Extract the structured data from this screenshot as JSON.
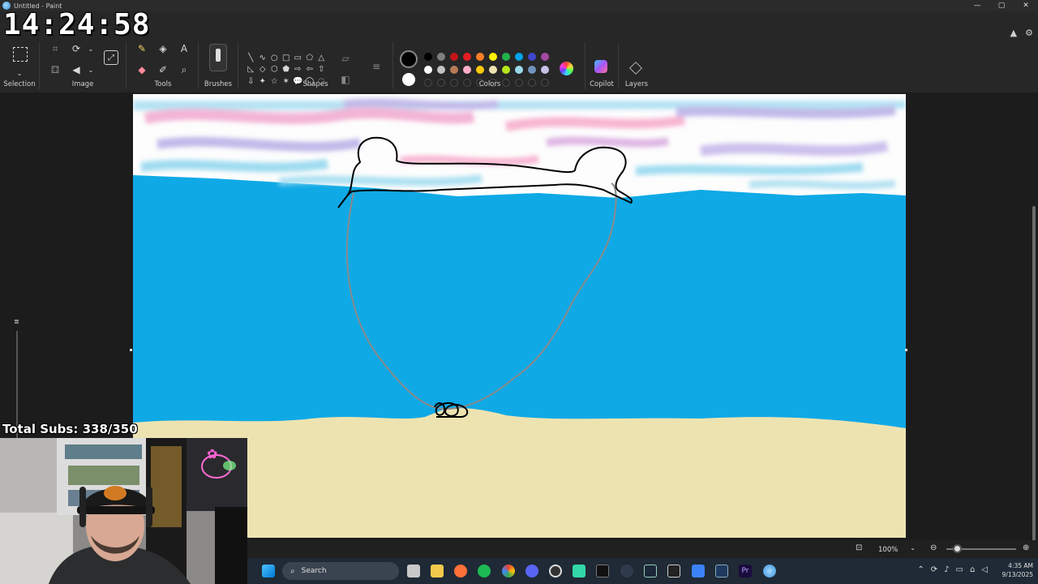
{
  "window": {
    "title": "Untitled - Paint",
    "controls": {
      "minimize": "—",
      "maximize": "▢",
      "close": "✕"
    }
  },
  "overlay": {
    "clock": "14:24:58",
    "subs": "Total Subs: 338/350"
  },
  "ribbon": {
    "groups": {
      "selection": "Selection",
      "image": "Image",
      "tools": "Tools",
      "brushes": "Brushes",
      "shapes": "Shapes",
      "colors": "Colors",
      "copilot": "Copilot",
      "layers": "Layers"
    },
    "shapes_glyphs": [
      "╲",
      "∿",
      "○",
      "□",
      "▭",
      "⬠",
      "△",
      "◺",
      "◇",
      "⬡",
      "⬟",
      "⇨",
      "⇦",
      "⇧",
      "⇩",
      "✦",
      "☆",
      "✶",
      "💬",
      "◯",
      "◌"
    ]
  },
  "colors": {
    "primary": "#000000",
    "secondary": "#ffffff",
    "row1": [
      "#000000",
      "#7f7f7f",
      "#c3161b",
      "#e51c23",
      "#ff7f27",
      "#fff200",
      "#22b14c",
      "#00a2e8",
      "#3f48cc",
      "#a349a4"
    ],
    "row2": [
      "#ffffff",
      "#c3c3c3",
      "#b97a57",
      "#ffaec9",
      "#ffc90e",
      "#efe4b0",
      "#b5e61d",
      "#99d9ea",
      "#7092be",
      "#c8bfe7"
    ],
    "custom_slots": 10,
    "sky_blue": "#0fa9e6",
    "sand": "#ede3b1"
  },
  "status": {
    "zoom": "100%"
  },
  "taskbar": {
    "search_placeholder": "Search",
    "time": "4:35 AM",
    "date": "9/13/2025"
  }
}
